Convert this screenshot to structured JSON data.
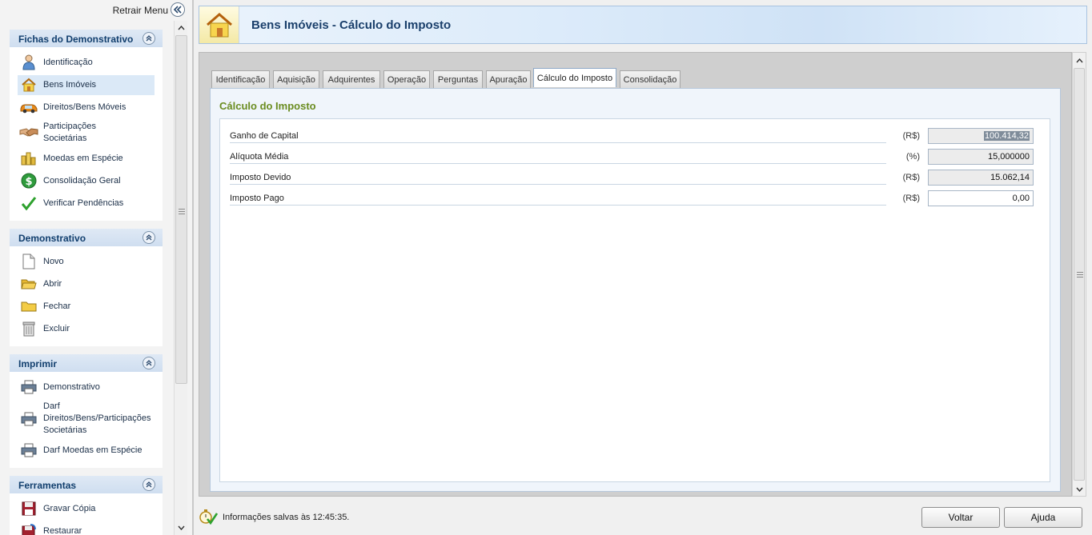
{
  "left": {
    "retract_label": "Retrair Menu",
    "sections": [
      {
        "title": "Fichas do Demonstrativo",
        "items": [
          {
            "label": "Identificação",
            "icon": "person-icon"
          },
          {
            "label": "Bens Imóveis",
            "icon": "house-icon",
            "selected": true
          },
          {
            "label": "Direitos/Bens Móveis",
            "icon": "car-icon"
          },
          {
            "label": "Participações Societárias",
            "icon": "handshake-icon"
          },
          {
            "label": "Moedas em Espécie",
            "icon": "coins-icon"
          },
          {
            "label": "Consolidação Geral",
            "icon": "dollar-icon"
          },
          {
            "label": "Verificar Pendências",
            "icon": "checkmark-icon"
          }
        ]
      },
      {
        "title": "Demonstrativo",
        "items": [
          {
            "label": "Novo",
            "icon": "new-document-icon"
          },
          {
            "label": "Abrir",
            "icon": "open-folder-icon"
          },
          {
            "label": "Fechar",
            "icon": "folder-icon"
          },
          {
            "label": "Excluir",
            "icon": "trash-icon"
          }
        ]
      },
      {
        "title": "Imprimir",
        "items": [
          {
            "label": "Demonstrativo",
            "icon": "printer-icon"
          },
          {
            "label": "Darf Direitos/Bens/Participações Societárias",
            "icon": "printer-icon"
          },
          {
            "label": "Darf Moedas em Espécie",
            "icon": "printer-icon"
          }
        ]
      },
      {
        "title": "Ferramentas",
        "items": [
          {
            "label": "Gravar Cópia",
            "icon": "floppy-icon"
          },
          {
            "label": "Restaurar",
            "icon": "floppy-restore-icon"
          }
        ]
      }
    ]
  },
  "header": {
    "title": "Bens Imóveis - Cálculo do Imposto",
    "icon": "house-icon"
  },
  "tabs": [
    {
      "label": "Identificação"
    },
    {
      "label": "Aquisição"
    },
    {
      "label": "Adquirentes"
    },
    {
      "label": "Operação"
    },
    {
      "label": "Perguntas"
    },
    {
      "label": "Apuração"
    },
    {
      "label": "Cálculo do Imposto",
      "active": true
    },
    {
      "label": "Consolidação"
    }
  ],
  "panel": {
    "title": "Cálculo do Imposto",
    "fields": [
      {
        "label": "Ganho de Capital",
        "unit": "(R$)",
        "value": "100.414,32",
        "editable": false,
        "highlighted": true
      },
      {
        "label": "Alíquota Média",
        "unit": "(%)",
        "value": "15,000000",
        "editable": false
      },
      {
        "label": "Imposto Devido",
        "unit": "(R$)",
        "value": "15.062,14",
        "editable": false
      },
      {
        "label": "Imposto Pago",
        "unit": "(R$)",
        "value": "0,00",
        "editable": true
      }
    ]
  },
  "status": {
    "text": "Informações salvas às 12:45:35."
  },
  "buttons": {
    "back": "Voltar",
    "help": "Ajuda"
  },
  "colors": {
    "section_header": "#cfdef0",
    "title_blue": "#1a3f6b",
    "panel_title_green": "#6a8c1f"
  }
}
